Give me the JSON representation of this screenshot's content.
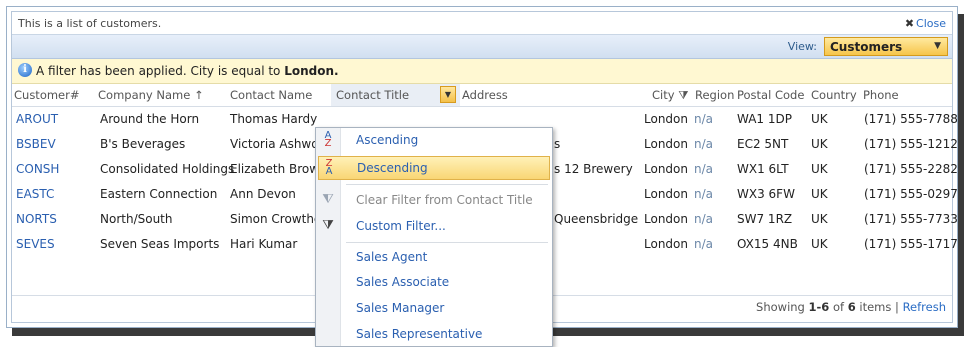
{
  "title_bar": {
    "description": "This is a list of customers.",
    "close_label": "Close",
    "close_icon": "close-icon"
  },
  "view_bar": {
    "label": "View:",
    "selected": "Customers"
  },
  "filter_bar": {
    "prefix": "A filter has been applied.",
    "field": "City",
    "middle": "is equal to",
    "value": "London."
  },
  "columns": {
    "customer": "Customer#",
    "company": "Company Name",
    "company_sort": "↑",
    "contact": "Contact Name",
    "title": "Contact Title",
    "address": "Address",
    "city": "City",
    "region": "Region",
    "postal": "Postal Code",
    "country": "Country",
    "phone": "Phone"
  },
  "rows": [
    {
      "id": "AROUT",
      "company": "Around the Horn",
      "contact": "Thomas Hardy",
      "address": "",
      "city": "London",
      "region": "n/a",
      "postal": "WA1 1DP",
      "country": "UK",
      "phone": "(171) 555-7788"
    },
    {
      "id": "BSBEV",
      "company": "B's Beverages",
      "contact": "Victoria Ashwor",
      "address": "s",
      "city": "London",
      "region": "n/a",
      "postal": "EC2 5NT",
      "country": "UK",
      "phone": "(171) 555-1212"
    },
    {
      "id": "CONSH",
      "company": "Consolidated Holdings",
      "contact": "Elizabeth Brown",
      "address": "s 12 Brewery",
      "city": "London",
      "region": "n/a",
      "postal": "WX1 6LT",
      "country": "UK",
      "phone": "(171) 555-2282"
    },
    {
      "id": "EASTC",
      "company": "Eastern Connection",
      "contact": "Ann Devon",
      "address": "",
      "city": "London",
      "region": "n/a",
      "postal": "WX3 6FW",
      "country": "UK",
      "phone": "(171) 555-0297"
    },
    {
      "id": "NORTS",
      "company": "North/South",
      "contact": "Simon Crowther",
      "address": "Queensbridge",
      "city": "London",
      "region": "n/a",
      "postal": "SW7 1RZ",
      "country": "UK",
      "phone": "(171) 555-7733"
    },
    {
      "id": "SEVES",
      "company": "Seven Seas Imports",
      "contact": "Hari Kumar",
      "address": "",
      "city": "London",
      "region": "n/a",
      "postal": "OX15 4NB",
      "country": "UK",
      "phone": "(171) 555-1717"
    }
  ],
  "footer": {
    "showing": "Showing",
    "range": "1-6",
    "of": "of",
    "total": "6",
    "items": "items",
    "sep": "|",
    "refresh": "Refresh"
  },
  "menu": {
    "ascending": "Ascending",
    "descending": "Descending",
    "clear_filter": "Clear Filter from Contact Title",
    "custom_filter": "Custom Filter...",
    "values": [
      "Sales Agent",
      "Sales Associate",
      "Sales Manager",
      "Sales Representative"
    ]
  },
  "colors": {
    "link": "#2a5fb0",
    "accent": "#f6c54a",
    "filter_bg": "#fff8d2"
  }
}
